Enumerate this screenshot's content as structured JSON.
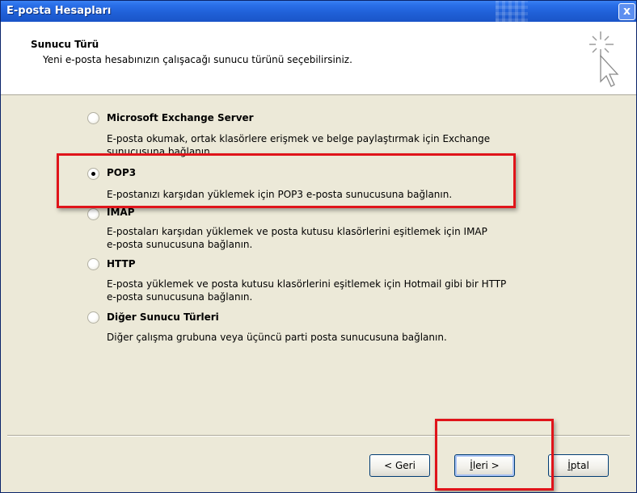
{
  "window": {
    "title": "E-posta Hesapları",
    "close_label": "x"
  },
  "header": {
    "title": "Sunucu Türü",
    "subtitle": "Yeni e-posta hesabınızın çalışacağı sunucu türünü seçebilirsiniz.",
    "icon": "wizard-cursor-icon"
  },
  "options": [
    {
      "label": "Microsoft Exchange Server",
      "selected": false,
      "desc1": "E-posta okumak, ortak klasörlere erişmek ve belge paylaştırmak için Exchange",
      "desc2": "sunucusuna bağlanın."
    },
    {
      "label": "POP3",
      "selected": true,
      "desc1": "E-postanızı karşıdan yüklemek için POP3 e-posta sunucusuna bağlanın.",
      "desc2": ""
    },
    {
      "label": "IMAP",
      "selected": false,
      "desc1": "E-postaları karşıdan yüklemek ve posta kutusu klasörlerini eşitlemek için IMAP",
      "desc2": "e-posta sunucusuna bağlanın."
    },
    {
      "label": "HTTP",
      "selected": false,
      "desc1": "E-posta yüklemek ve posta kutusu klasörlerini eşitlemek için Hotmail gibi bir HTTP",
      "desc2": "e-posta sunucusuna bağlanın."
    },
    {
      "label": "Diğer Sunucu Türleri",
      "selected": false,
      "desc1": "Diğer çalışma grubuna veya üçüncü parti posta sunucusuna bağlanın.",
      "desc2": ""
    }
  ],
  "buttons": {
    "back": "< Geri",
    "next_underlined": "İ",
    "next_rest": "leri >",
    "cancel_underlined": "İ",
    "cancel_rest": "ptal"
  },
  "colors": {
    "titlebar": "#1f5fd6",
    "highlight": "#e0141a",
    "dialog_bg": "#ece9d8"
  }
}
